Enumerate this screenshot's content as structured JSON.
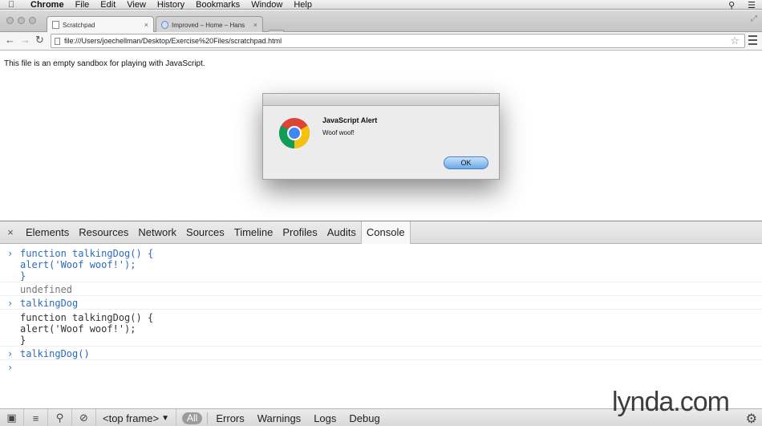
{
  "menubar": {
    "items": [
      {
        "label": "Chrome",
        "bold": true
      },
      {
        "label": "File"
      },
      {
        "label": "Edit"
      },
      {
        "label": "View"
      },
      {
        "label": "History"
      },
      {
        "label": "Bookmarks"
      },
      {
        "label": "Window"
      },
      {
        "label": "Help"
      }
    ]
  },
  "tabs": [
    {
      "title": "Scratchpad",
      "close": "×"
    },
    {
      "title": "Improved – Home – Hans",
      "close": "×"
    }
  ],
  "toolbar": {
    "back": "←",
    "forward": "→",
    "reload": "↻",
    "url": "file:///Users/joechellman/Desktop/Exercise%20Files/scratchpad.html",
    "star": "☆"
  },
  "page": {
    "text": "This file is an empty sandbox for playing with JavaScript."
  },
  "alert": {
    "title": "JavaScript Alert",
    "message": "Woof woof!",
    "ok_label": "OK"
  },
  "devtools": {
    "close": "×",
    "tabs": [
      "Elements",
      "Resources",
      "Network",
      "Sources",
      "Timeline",
      "Profiles",
      "Audits",
      "Console"
    ],
    "active_tab": "Console",
    "console": {
      "prompt": "›",
      "entries": [
        {
          "kind": "input",
          "lines": [
            "function talkingDog() {",
            "alert('Woof woof!');",
            "}"
          ]
        },
        {
          "kind": "undef",
          "lines": [
            "undefined"
          ]
        },
        {
          "kind": "input",
          "lines": [
            "talkingDog"
          ]
        },
        {
          "kind": "result",
          "lines": [
            "function talkingDog() {",
            "alert('Woof woof!');",
            "}"
          ]
        },
        {
          "kind": "input",
          "lines": [
            "talkingDog()"
          ]
        }
      ]
    },
    "statusbar": {
      "frame": "<top frame>",
      "dropdown_arrow": "▼",
      "filters": [
        "All",
        "Errors",
        "Warnings",
        "Logs",
        "Debug"
      ]
    }
  },
  "watermark": "lynda.com",
  "icons": {
    "apple": "apple-icon",
    "search": "search-icon",
    "clear": "clear-console-icon",
    "settings": "gear-icon"
  }
}
